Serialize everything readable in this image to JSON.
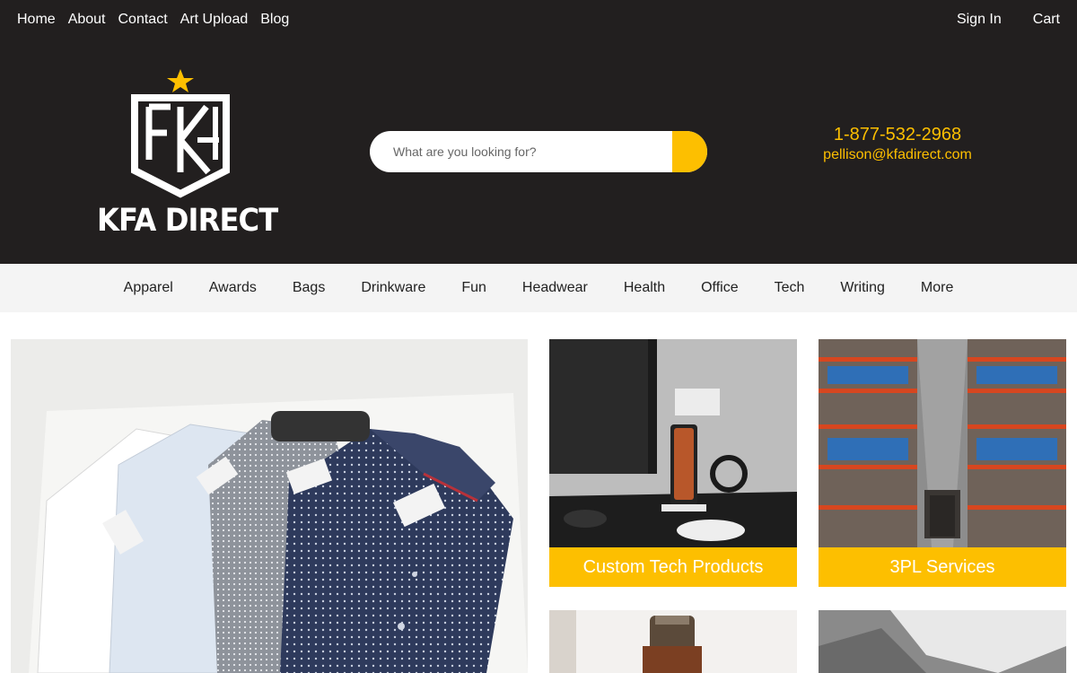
{
  "top_nav": {
    "left": [
      "Home",
      "About",
      "Contact",
      "Art Upload",
      "Blog"
    ],
    "sign_in": "Sign In",
    "cart": "Cart"
  },
  "brand": {
    "name": "KFA DIRECT",
    "accent_color": "#fdbf00",
    "header_bg": "#221f1f"
  },
  "search": {
    "placeholder": "What are you looking for?",
    "icon": "search-icon"
  },
  "contact": {
    "phone": "1-877-532-2968",
    "email": "pellison@kfadirect.com"
  },
  "categories": [
    "Apparel",
    "Awards",
    "Bags",
    "Drinkware",
    "Fun",
    "Headwear",
    "Health",
    "Office",
    "Tech",
    "Writing",
    "More"
  ],
  "tiles": {
    "tech": {
      "label": "Custom Tech Products"
    },
    "logistics": {
      "label": "3PL Services"
    }
  }
}
